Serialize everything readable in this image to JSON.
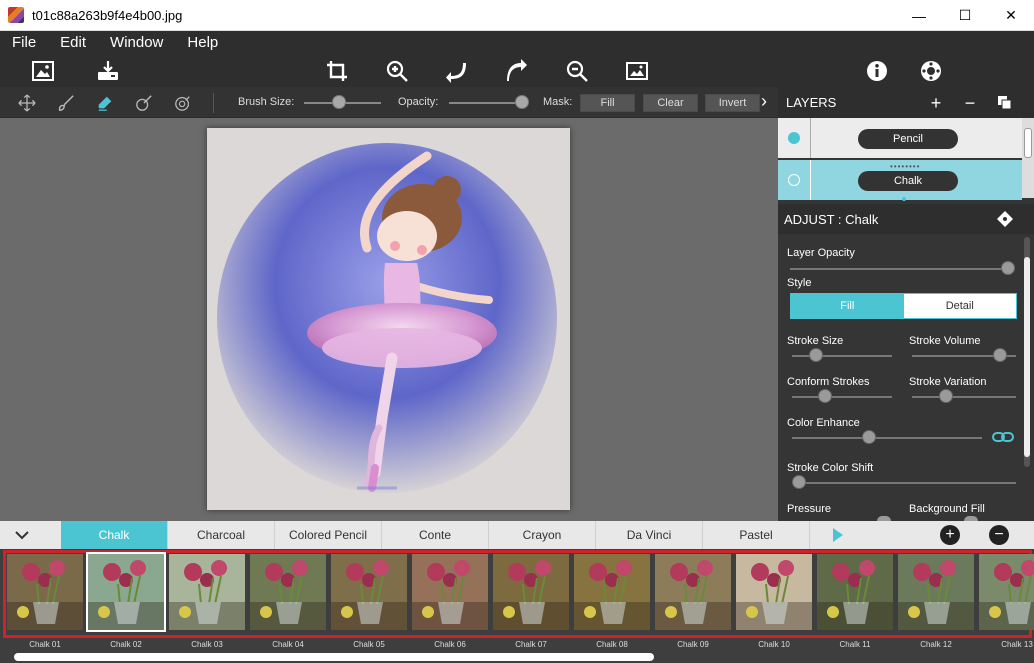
{
  "window": {
    "title": "t01c88a263b9f4e4b00.jpg",
    "min": "—",
    "max": "☐",
    "close": "✕"
  },
  "menu": {
    "items": [
      "File",
      "Edit",
      "Window",
      "Help"
    ]
  },
  "brushbar": {
    "brush_size_label": "Brush Size:",
    "brush_size_value": 0.45,
    "opacity_label": "Opacity:",
    "opacity_value": 1.0,
    "mask_label": "Mask:",
    "fill_label": "Fill",
    "clear_label": "Clear",
    "invert_label": "Invert",
    "more": "›"
  },
  "layers": {
    "title": "LAYERS",
    "add": "+",
    "remove": "−",
    "items": [
      {
        "name": "Pencil",
        "selected": false
      },
      {
        "name": "Chalk",
        "selected": true
      }
    ]
  },
  "adjust": {
    "title": "ADJUST : Chalk",
    "layer_opacity_label": "Layer Opacity",
    "layer_opacity_value": 1.0,
    "style_label": "Style",
    "style_fill": "Fill",
    "style_detail": "Detail",
    "stroke_size_label": "Stroke Size",
    "stroke_size_value": 0.2,
    "stroke_volume_label": "Stroke Volume",
    "stroke_volume_value": 0.9,
    "conform_strokes_label": "Conform Strokes",
    "conform_strokes_value": 0.3,
    "stroke_variation_label": "Stroke Variation",
    "stroke_variation_value": 0.3,
    "color_enhance_label": "Color Enhance",
    "color_enhance_value": 0.4,
    "stroke_color_shift_label": "Stroke Color Shift",
    "stroke_color_shift_value": 0.0,
    "pressure_label": "Pressure",
    "background_fill_label": "Background Fill"
  },
  "tabs": {
    "items": [
      "Chalk",
      "Charcoal",
      "Colored Pencil",
      "Conte",
      "Crayon",
      "Da Vinci",
      "Pastel"
    ],
    "active": "Chalk",
    "add": "+",
    "remove": "−"
  },
  "presets": {
    "items": [
      "Chalk 01",
      "Chalk 02",
      "Chalk 03",
      "Chalk 04",
      "Chalk 05",
      "Chalk 06",
      "Chalk 07",
      "Chalk 08",
      "Chalk 09",
      "Chalk 10",
      "Chalk 11",
      "Chalk 12",
      "Chalk 13"
    ],
    "selected": "Chalk 02"
  },
  "colors": {
    "accent": "#4cc5d3",
    "highlight_frame": "#d0222a"
  }
}
